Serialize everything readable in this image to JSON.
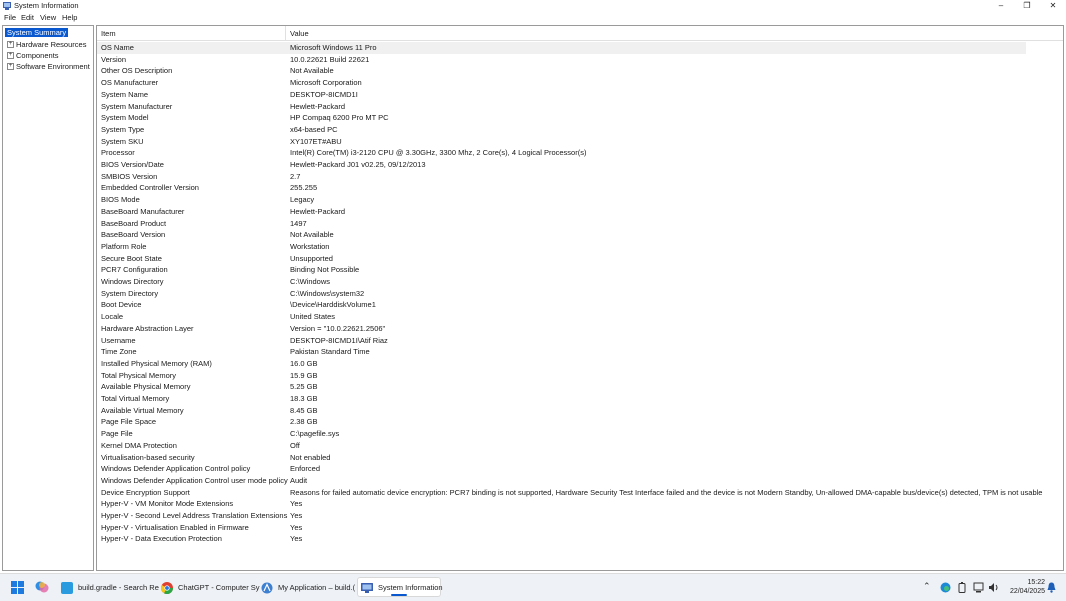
{
  "window": {
    "title": "System Information"
  },
  "menu": [
    "File",
    "Edit",
    "View",
    "Help"
  ],
  "tree": {
    "selected": "System Summary",
    "children": [
      "Hardware Resources",
      "Components",
      "Software Environment"
    ]
  },
  "table": {
    "headers": {
      "item": "Item",
      "value": "Value"
    },
    "rows": [
      {
        "item": "OS Name",
        "value": "Microsoft Windows 11 Pro"
      },
      {
        "item": "Version",
        "value": "10.0.22621 Build 22621"
      },
      {
        "item": "Other OS Description",
        "value": "Not Available"
      },
      {
        "item": "OS Manufacturer",
        "value": "Microsoft Corporation"
      },
      {
        "item": "System Name",
        "value": "DESKTOP-8ICMD1I"
      },
      {
        "item": "System Manufacturer",
        "value": "Hewlett-Packard"
      },
      {
        "item": "System Model",
        "value": "HP Compaq 6200 Pro MT PC"
      },
      {
        "item": "System Type",
        "value": "x64-based PC"
      },
      {
        "item": "System SKU",
        "value": "XY107ET#ABU"
      },
      {
        "item": "Processor",
        "value": "Intel(R) Core(TM) i3-2120 CPU @ 3.30GHz, 3300 Mhz, 2 Core(s), 4 Logical Processor(s)"
      },
      {
        "item": "BIOS Version/Date",
        "value": "Hewlett-Packard J01 v02.25, 09/12/2013"
      },
      {
        "item": "SMBIOS Version",
        "value": "2.7"
      },
      {
        "item": "Embedded Controller Version",
        "value": "255.255"
      },
      {
        "item": "BIOS Mode",
        "value": "Legacy"
      },
      {
        "item": "BaseBoard Manufacturer",
        "value": "Hewlett-Packard"
      },
      {
        "item": "BaseBoard Product",
        "value": "1497"
      },
      {
        "item": "BaseBoard Version",
        "value": "Not Available"
      },
      {
        "item": "Platform Role",
        "value": "Workstation"
      },
      {
        "item": "Secure Boot State",
        "value": "Unsupported"
      },
      {
        "item": "PCR7 Configuration",
        "value": "Binding Not Possible"
      },
      {
        "item": "Windows Directory",
        "value": "C:\\Windows"
      },
      {
        "item": "System Directory",
        "value": "C:\\Windows\\system32"
      },
      {
        "item": "Boot Device",
        "value": "\\Device\\HarddiskVolume1"
      },
      {
        "item": "Locale",
        "value": "United States"
      },
      {
        "item": "Hardware Abstraction Layer",
        "value": "Version = \"10.0.22621.2506\""
      },
      {
        "item": "Username",
        "value": "DESKTOP-8ICMD1I\\Atif Riaz"
      },
      {
        "item": "Time Zone",
        "value": "Pakistan Standard Time"
      },
      {
        "item": "Installed Physical Memory (RAM)",
        "value": "16.0 GB"
      },
      {
        "item": "Total Physical Memory",
        "value": "15.9 GB"
      },
      {
        "item": "Available Physical Memory",
        "value": "5.25 GB"
      },
      {
        "item": "Total Virtual Memory",
        "value": "18.3 GB"
      },
      {
        "item": "Available Virtual Memory",
        "value": "8.45 GB"
      },
      {
        "item": "Page File Space",
        "value": "2.38 GB"
      },
      {
        "item": "Page File",
        "value": "C:\\pagefile.sys"
      },
      {
        "item": "Kernel DMA Protection",
        "value": "Off"
      },
      {
        "item": "Virtualisation-based security",
        "value": "Not enabled"
      },
      {
        "item": "Windows Defender Application Control policy",
        "value": "Enforced"
      },
      {
        "item": "Windows Defender Application Control user mode policy",
        "value": "Audit"
      },
      {
        "item": "Device Encryption Support",
        "value": "Reasons for failed automatic device encryption: PCR7 binding is not supported, Hardware Security Test Interface failed and the device is not Modern Standby, Un-allowed DMA-capable bus/device(s) detected, TPM is not usable"
      },
      {
        "item": "Hyper-V - VM Monitor Mode Extensions",
        "value": "Yes"
      },
      {
        "item": "Hyper-V - Second Level Address Translation Extensions",
        "value": "Yes"
      },
      {
        "item": "Hyper-V - Virtualisation Enabled in Firmware",
        "value": "Yes"
      },
      {
        "item": "Hyper-V - Data Execution Protection",
        "value": "Yes"
      }
    ]
  },
  "taskbar": {
    "apps": [
      {
        "name": "build-gradle",
        "label": "build.gradle - Search Re",
        "icon": "file-icon",
        "color": "#2b9be0"
      },
      {
        "name": "chatgpt",
        "label": "ChatGPT - Computer Sy",
        "icon": "chrome-icon",
        "color": "#e0402f"
      },
      {
        "name": "my-application",
        "label": "My Application – build.(",
        "icon": "android-studio-icon",
        "color": "#3d7fd1"
      },
      {
        "name": "system-information",
        "label": "System Information",
        "icon": "system-info-icon",
        "color": "#4a6fb5"
      }
    ],
    "clock_time": "15:22",
    "clock_date": "22/04/2025"
  },
  "colors": {
    "accent": "#0a58d0",
    "selected_row": "#f0f0f0",
    "taskbar": "#eef1f6"
  }
}
